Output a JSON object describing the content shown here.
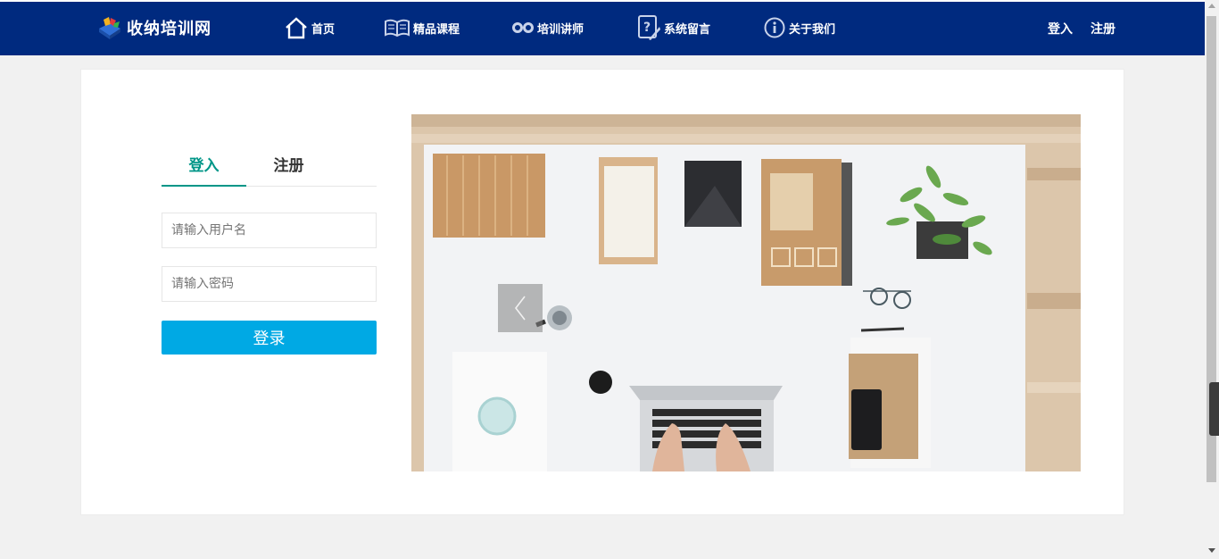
{
  "site": {
    "logo_text": "收纳培训网"
  },
  "nav": {
    "items": [
      {
        "label": "首页",
        "icon": "home-icon"
      },
      {
        "label": "精品课程",
        "icon": "book-icon"
      },
      {
        "label": "培训讲师",
        "icon": "teacher-icon"
      },
      {
        "label": "系统留言",
        "icon": "message-icon"
      },
      {
        "label": "关于我们",
        "icon": "info-icon"
      }
    ]
  },
  "auth": {
    "login": "登入",
    "register": "注册"
  },
  "form": {
    "tabs": [
      {
        "label": "登入",
        "active": true
      },
      {
        "label": "注册",
        "active": false
      }
    ],
    "username_placeholder": "请输入用户名",
    "password_placeholder": "请输入密码",
    "submit_label": "登录"
  },
  "carousel": {
    "prev_icon": "chevron-left-icon"
  },
  "colors": {
    "nav_bg": "#002a7f",
    "accent": "#009688",
    "button": "#00a9e4"
  }
}
